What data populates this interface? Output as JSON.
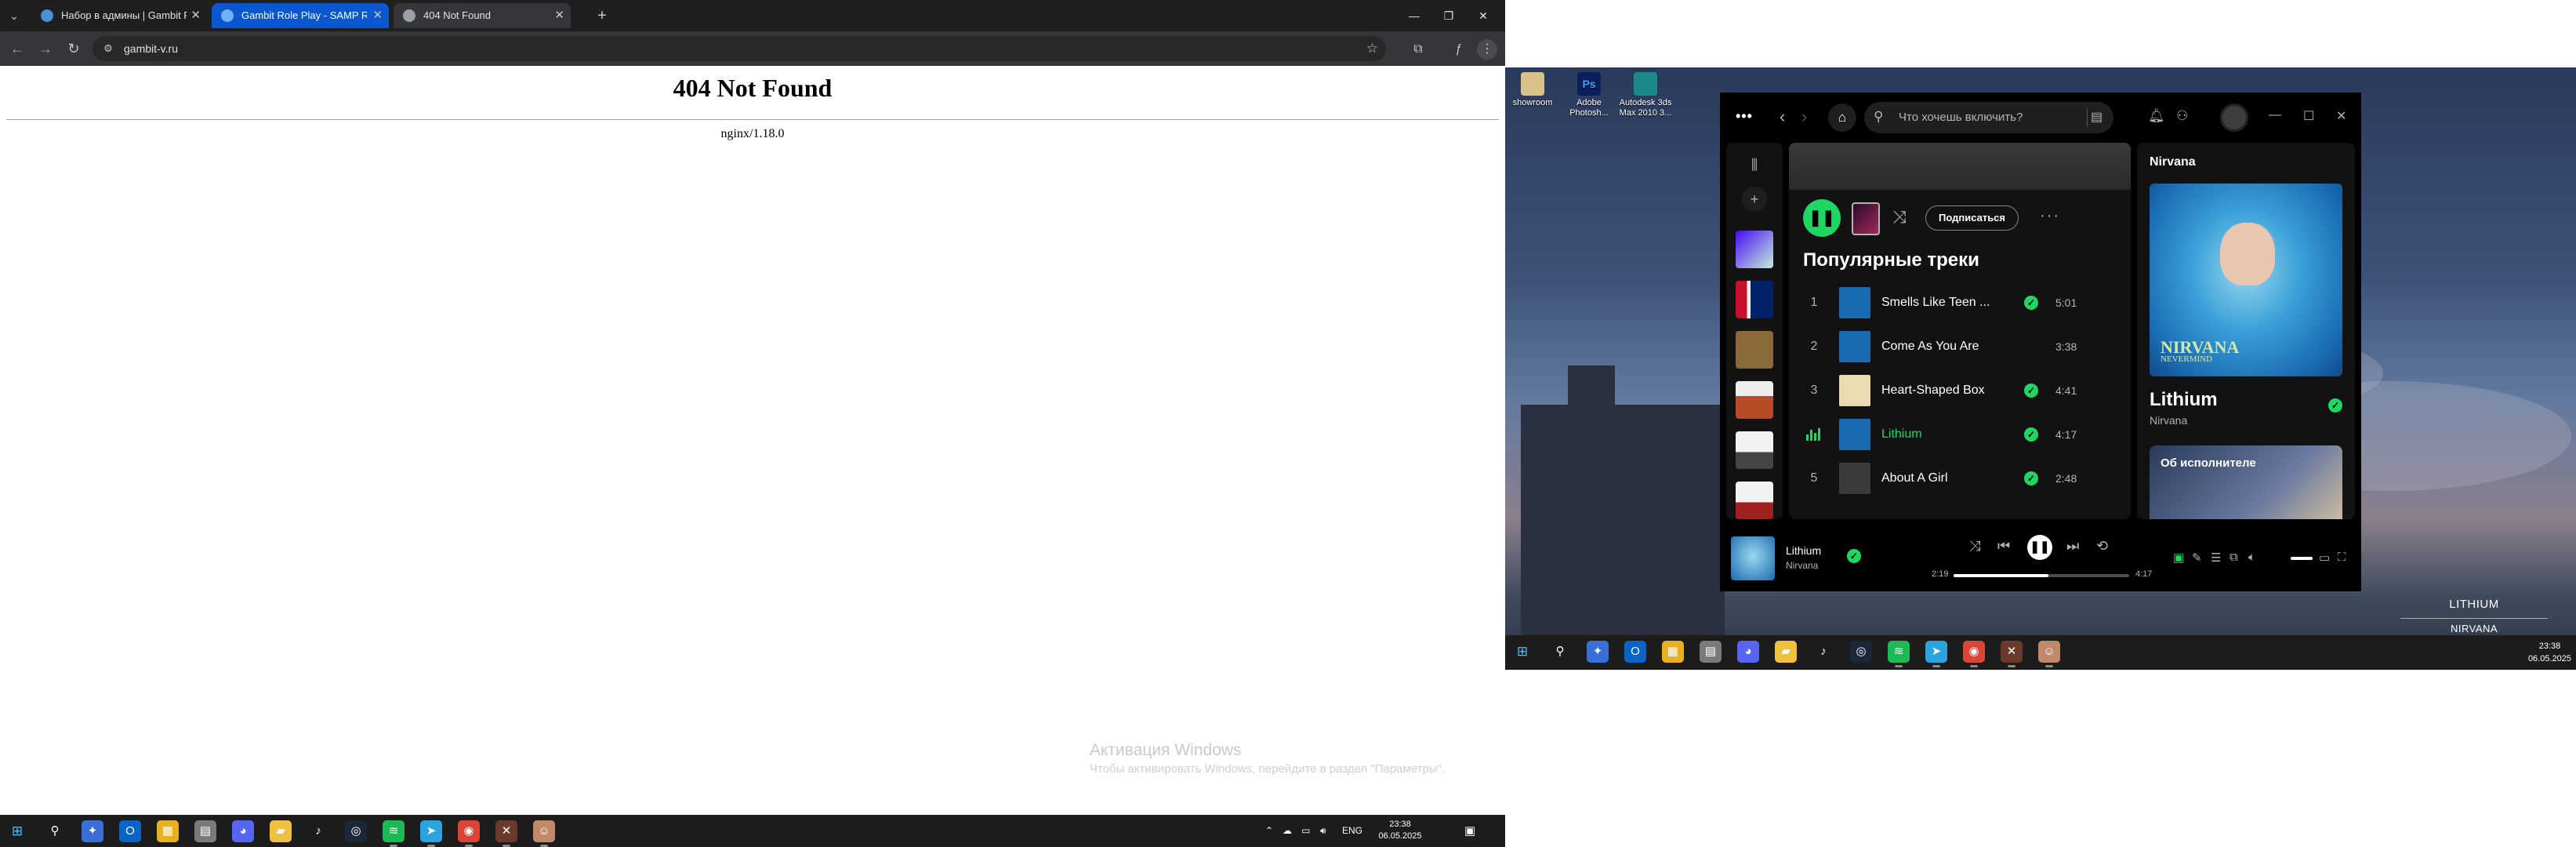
{
  "browser": {
    "tabs": [
      {
        "title": "Набор в админы | Gambit Role...",
        "favicon_color": "#4a90d9"
      },
      {
        "title": "Gambit Role Play - SAMP RP ci...",
        "favicon_color": "#6fb1ff"
      },
      {
        "title": "404 Not Found",
        "favicon_color": "#9aa0a6"
      }
    ],
    "url": "gambit-v.ru"
  },
  "page": {
    "heading": "404 Not Found",
    "server": "nginx/1.18.0"
  },
  "watermark": {
    "title": "Активация Windows",
    "subtitle": "Чтобы активировать Windows, перейдите в раздел \"Параметры\"."
  },
  "taskbar_left": {
    "tray_lang": "ENG",
    "time": "23:38",
    "date": "06.05.2025"
  },
  "desktop": {
    "icons": [
      {
        "label": "showroom",
        "color": "#d9c28a"
      },
      {
        "label": "Adobe Photosh...",
        "color": "#0a1f5c"
      },
      {
        "label": "Autodesk 3ds Max 2010 3...",
        "color": "#1a8a8a"
      }
    ],
    "lyric_title": "LITHIUM",
    "lyric_artist": "NIRVANA"
  },
  "taskbar_right": {
    "time": "23:38",
    "date": "06.05.2025"
  },
  "spotify": {
    "search_placeholder": "Что хочешь включить?",
    "follow_label": "Подписаться",
    "section_title": "Популярные треки",
    "tracks": [
      {
        "num": "1",
        "name": "Smells Like Teen ...",
        "duration": "5:01",
        "saved": true,
        "cover": "#1a6ab0"
      },
      {
        "num": "2",
        "name": "Come As You Are",
        "duration": "3:38",
        "saved": false,
        "cover": "#1a6ab0"
      },
      {
        "num": "3",
        "name": "Heart-Shaped Box",
        "duration": "4:41",
        "saved": true,
        "cover": "#e8dcb0"
      },
      {
        "num": "",
        "name": "Lithium",
        "duration": "4:17",
        "saved": true,
        "cover": "#1a6ab0",
        "playing": true
      },
      {
        "num": "5",
        "name": "About A Girl",
        "duration": "2:48",
        "saved": true,
        "cover": "#3a3a3a"
      }
    ],
    "now_playing_artist_header": "Nirvana",
    "now_playing_title": "Lithium",
    "now_playing_artist": "Nirvana",
    "cover_brand": "NIRVANA",
    "cover_brand_sub": "NEVERMIND",
    "about_label": "Об исполнителе",
    "player": {
      "title": "Lithium",
      "artist": "Nirvana",
      "elapsed": "2:19",
      "total": "4:17",
      "progress": 0.54
    },
    "accent": "#1ed760"
  }
}
